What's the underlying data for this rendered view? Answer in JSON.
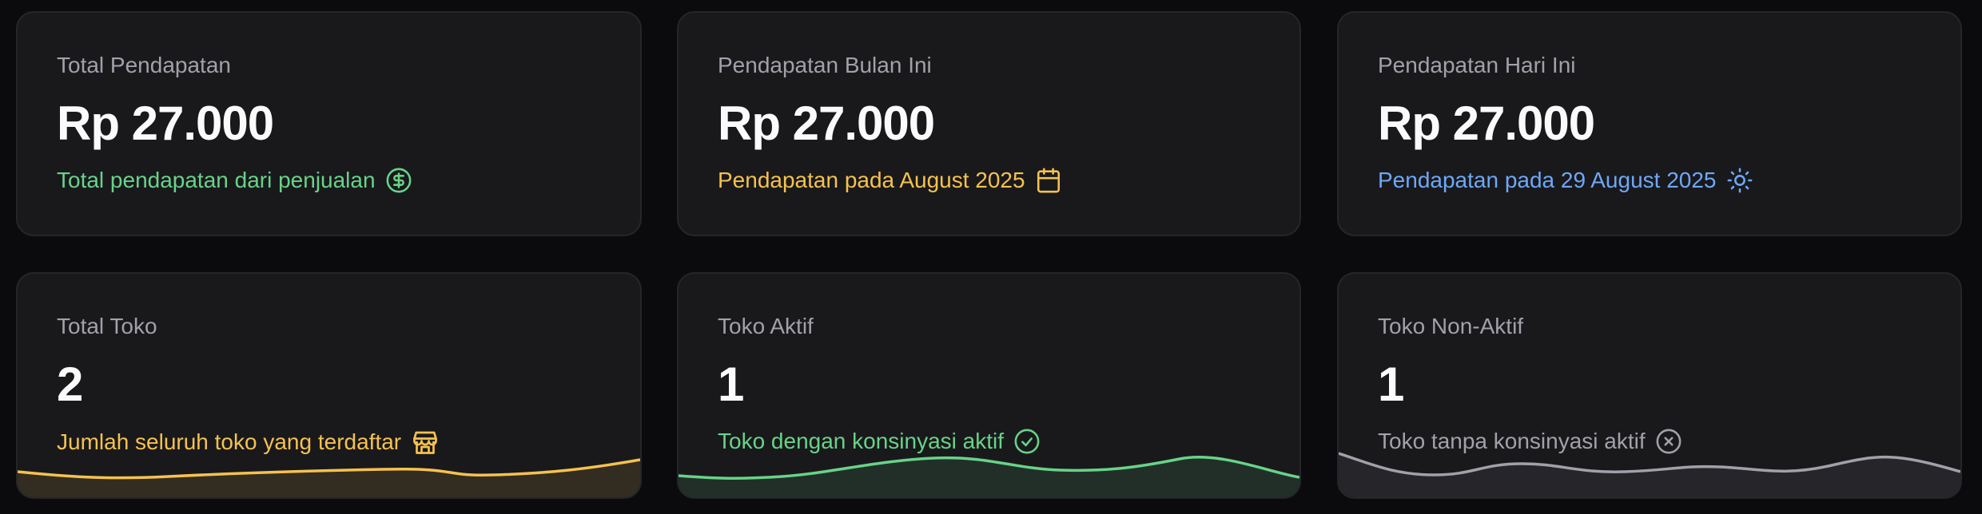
{
  "revenue_cards": [
    {
      "title": "Total Pendapatan",
      "value": "Rp 27.000",
      "subtitle": "Total pendapatan dari penjualan",
      "icon": "dollar-circle-icon",
      "color": "#68d388"
    },
    {
      "title": "Pendapatan Bulan Ini",
      "value": "Rp 27.000",
      "subtitle": "Pendapatan pada August 2025",
      "icon": "calendar-icon",
      "color": "#f6c24e"
    },
    {
      "title": "Pendapatan Hari Ini",
      "value": "Rp 27.000",
      "subtitle": "Pendapatan pada 29 August 2025",
      "icon": "sun-icon",
      "color": "#6ea8f7"
    }
  ],
  "store_cards": [
    {
      "title": "Total Toko",
      "value": "2",
      "subtitle": "Jumlah seluruh toko yang terdaftar",
      "icon": "store-icon",
      "color": "#f6c24e"
    },
    {
      "title": "Toko Aktif",
      "value": "1",
      "subtitle": "Toko dengan konsinyasi aktif",
      "icon": "check-circle-icon",
      "color": "#68d388"
    },
    {
      "title": "Toko Non-Aktif",
      "value": "1",
      "subtitle": "Toko tanpa konsinyasi aktif",
      "icon": "x-circle-icon",
      "color": "#a1a1aa"
    }
  ]
}
